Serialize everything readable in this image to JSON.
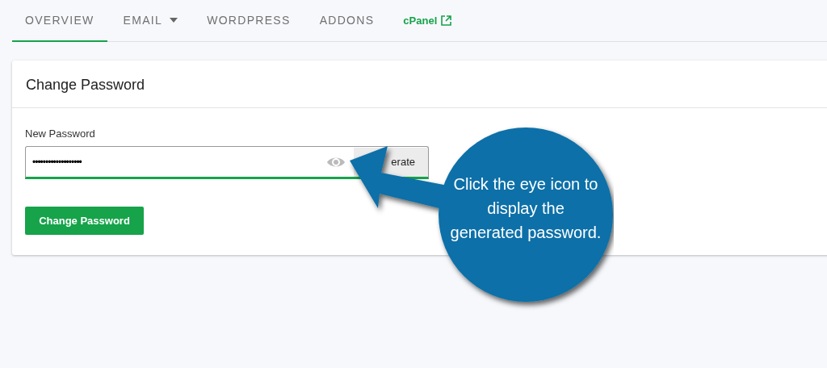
{
  "tabs": [
    {
      "label": "OVERVIEW",
      "kind": "plain",
      "selected": true
    },
    {
      "label": "EMAIL",
      "kind": "dropdown",
      "selected": false
    },
    {
      "label": "WORDPRESS",
      "kind": "plain",
      "selected": false
    },
    {
      "label": "ADDONS",
      "kind": "plain",
      "selected": false
    },
    {
      "label": "cPanel",
      "kind": "external",
      "selected": false
    }
  ],
  "card": {
    "title": "Change Password",
    "field": {
      "label": "New Password",
      "value": "•••••••••••••••••••",
      "generate_button": "erate"
    },
    "submit_button": "Change Password"
  },
  "callout": {
    "text": "Click the eye icon to display the generated password."
  }
}
